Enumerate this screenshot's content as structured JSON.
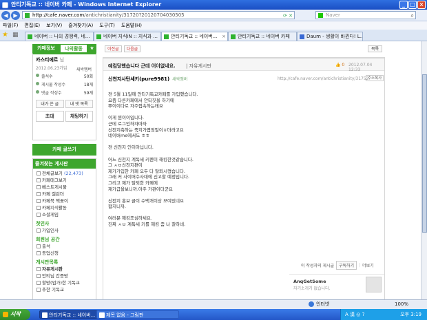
{
  "window": {
    "title": "안티기독교 :: 네이버 카페 - Windows Internet Explorer"
  },
  "address": {
    "url_host": "http://cafe.naver.com",
    "url_rest": "/antichristianity/31720?20120704030505",
    "search_placeholder": "Naver"
  },
  "menu": [
    "파일(F)",
    "편집(E)",
    "보기(V)",
    "즐겨찾기(A)",
    "도구(T)",
    "도움말(H)"
  ],
  "tabs": [
    {
      "label": "네이버 :: 나의 경쟁력, 네..."
    },
    {
      "label": "네이버 지식iN :: 지식과 ..."
    },
    {
      "label": "안티기독교 :: 네이버..."
    },
    {
      "label": "안티기독교 :: 네이버 카페"
    },
    {
      "label": "Daum - 생활이 바뀐다! L..."
    }
  ],
  "sidebar": {
    "tab_cafe_info": "카페정보",
    "tab_my_activity": "나의활동",
    "tab_star": "★",
    "cafe_name": "카스티에르",
    "cafe_name_suffix": "님",
    "since": "2012.06.23가입",
    "level": "새싹멤버",
    "stats": [
      {
        "label": "출석수",
        "value": "50회"
      },
      {
        "label": "게시물 작성수",
        "value": "18개"
      },
      {
        "label": "댓글 작성수",
        "value": "59개"
      }
    ],
    "my_posts_btn": "내가 쓴 글",
    "my_comments_btn": "내 댓 목록",
    "invite_btn": "초대",
    "chat_btn": "채팅하기",
    "write_btn": "카페 글쓰기",
    "fav_head": "즐겨찾는 게시판",
    "fav_items": [
      {
        "label": "전체글보기",
        "count": "(22,473)"
      },
      {
        "label": "카페태그보기"
      },
      {
        "label": "베스트게시물"
      },
      {
        "label": "카페 갤린더"
      },
      {
        "label": "카페북 책꽂이"
      },
      {
        "label": "카페지식활동"
      },
      {
        "label": "소셜게임"
      }
    ],
    "greet_head": "첫인사",
    "greet_items": [
      {
        "label": "가입인사"
      }
    ],
    "attend_head": "회원님 공간",
    "attend_items": [
      {
        "label": "출석"
      },
      {
        "label": "등업신청"
      }
    ],
    "board_head": "게시판목록",
    "board_items": [
      {
        "label": "자유게시판"
      },
      {
        "label": "안티님 간증방"
      },
      {
        "label": "할망(업가)한 기독교"
      },
      {
        "label": "추한 기독교"
      }
    ]
  },
  "article": {
    "prev_btn": "이전글",
    "next_btn": "다음글",
    "list_btn": "목록",
    "title": "예컴당했습니다 근데 어이없네요.",
    "category": "| 자유게시판",
    "like": "0",
    "date": "2012.07.04 12:33",
    "author": "신천지사탄세키(pure9981)",
    "author_level": "새싹멤버",
    "article_url": "http://cafe.naver.com/antichristianity/31752",
    "copy_btn": "주소복사",
    "body": [
      "전 5월 11일에 안티기독교카페를 가입했습니다.",
      "요즘 다른카페에서 안티짓을 하기에",
      "뿌이이다로 자주접속하는데요",
      "",
      "이게 뭔이이입니다.",
      "근데 로그인하자마자",
      "신천지측하는 죽지가엽정말이ㅎ더라고요",
      "네이버me에서도 ㅎㅎ",
      "",
      "전 신천지 인이아닙니다.",
      "",
      "어느 신천지 계독세 키펜이 해킹한것같습니다.",
      "그 ㅅㅂ신천지편이",
      "제가가입한 카페 오두 다 탈퇴시켰습니다.",
      "그래 커 사이버수사대에 신고할 예정입니다.",
      "그리고 제가 탈퇴한 카페에",
      "재가급을보니까.아주 가관이더군요",
      "",
      "신천지 홍보 글이 수백개이상 모여있네요",
      "합치니까.",
      "",
      "여러분 해킹조심하세요.",
      "진짜 ㅅㅂ 계독세 키를 해킹 좀 나 잘하네."
    ],
    "writer_posts": "이 작성자의 게시글",
    "subscribe_btn": "구독하기",
    "more": "더보기",
    "profile_name": "AnqGetSome",
    "profile_desc": "자기소개가 없습니다."
  },
  "statusbar": {
    "zone": "인터넷",
    "zoom": "100%"
  },
  "taskbar": {
    "start": "시작",
    "task1": "안티기독교 :: 네이버...",
    "task2": "제목 없음 - 그림판",
    "tray": "A 漢 ◎ ?",
    "clock": "오후 3:19"
  }
}
